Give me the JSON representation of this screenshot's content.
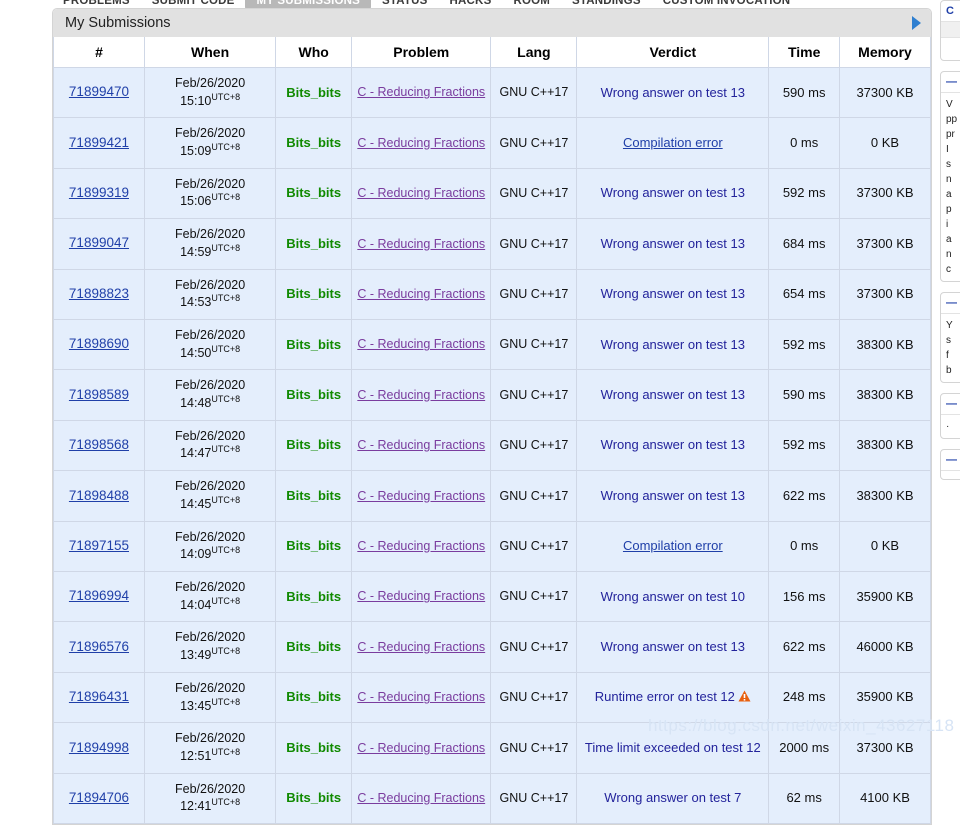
{
  "nav": {
    "tabs": [
      {
        "label": "PROBLEMS",
        "active": false
      },
      {
        "label": "SUBMIT CODE",
        "active": false
      },
      {
        "label": "MY SUBMISSIONS",
        "active": true
      },
      {
        "label": "STATUS",
        "active": false
      },
      {
        "label": "HACKS",
        "active": false
      },
      {
        "label": "ROOM",
        "active": false
      },
      {
        "label": "STANDINGS",
        "active": false
      },
      {
        "label": "CUSTOM INVOCATION",
        "active": false
      }
    ]
  },
  "panel": {
    "caption": "My Submissions",
    "collapse_arrow_icon": "triangle-right-icon",
    "accent_color": "#2f7fd0"
  },
  "table": {
    "columns": [
      "#",
      "When",
      "Who",
      "Problem",
      "Lang",
      "Verdict",
      "Time",
      "Memory"
    ],
    "rows": [
      {
        "id": "71899470",
        "date": "Feb/26/2020",
        "time": "15:10",
        "tz": "UTC+8",
        "who": "Bits_bits",
        "problem": "C - Reducing Fractions",
        "lang": "GNU C++17",
        "verdict": "Wrong answer on test 13",
        "verdict_is_link": false,
        "warn": false,
        "runtime": "590 ms",
        "memory": "37300 KB"
      },
      {
        "id": "71899421",
        "date": "Feb/26/2020",
        "time": "15:09",
        "tz": "UTC+8",
        "who": "Bits_bits",
        "problem": "C - Reducing Fractions",
        "lang": "GNU C++17",
        "verdict": "Compilation error",
        "verdict_is_link": true,
        "warn": false,
        "runtime": "0 ms",
        "memory": "0 KB"
      },
      {
        "id": "71899319",
        "date": "Feb/26/2020",
        "time": "15:06",
        "tz": "UTC+8",
        "who": "Bits_bits",
        "problem": "C - Reducing Fractions",
        "lang": "GNU C++17",
        "verdict": "Wrong answer on test 13",
        "verdict_is_link": false,
        "warn": false,
        "runtime": "592 ms",
        "memory": "37300 KB"
      },
      {
        "id": "71899047",
        "date": "Feb/26/2020",
        "time": "14:59",
        "tz": "UTC+8",
        "who": "Bits_bits",
        "problem": "C - Reducing Fractions",
        "lang": "GNU C++17",
        "verdict": "Wrong answer on test 13",
        "verdict_is_link": false,
        "warn": false,
        "runtime": "684 ms",
        "memory": "37300 KB"
      },
      {
        "id": "71898823",
        "date": "Feb/26/2020",
        "time": "14:53",
        "tz": "UTC+8",
        "who": "Bits_bits",
        "problem": "C - Reducing Fractions",
        "lang": "GNU C++17",
        "verdict": "Wrong answer on test 13",
        "verdict_is_link": false,
        "warn": false,
        "runtime": "654 ms",
        "memory": "37300 KB"
      },
      {
        "id": "71898690",
        "date": "Feb/26/2020",
        "time": "14:50",
        "tz": "UTC+8",
        "who": "Bits_bits",
        "problem": "C - Reducing Fractions",
        "lang": "GNU C++17",
        "verdict": "Wrong answer on test 13",
        "verdict_is_link": false,
        "warn": false,
        "runtime": "592 ms",
        "memory": "38300 KB"
      },
      {
        "id": "71898589",
        "date": "Feb/26/2020",
        "time": "14:48",
        "tz": "UTC+8",
        "who": "Bits_bits",
        "problem": "C - Reducing Fractions",
        "lang": "GNU C++17",
        "verdict": "Wrong answer on test 13",
        "verdict_is_link": false,
        "warn": false,
        "runtime": "590 ms",
        "memory": "38300 KB"
      },
      {
        "id": "71898568",
        "date": "Feb/26/2020",
        "time": "14:47",
        "tz": "UTC+8",
        "who": "Bits_bits",
        "problem": "C - Reducing Fractions",
        "lang": "GNU C++17",
        "verdict": "Wrong answer on test 13",
        "verdict_is_link": false,
        "warn": false,
        "runtime": "592 ms",
        "memory": "38300 KB"
      },
      {
        "id": "71898488",
        "date": "Feb/26/2020",
        "time": "14:45",
        "tz": "UTC+8",
        "who": "Bits_bits",
        "problem": "C - Reducing Fractions",
        "lang": "GNU C++17",
        "verdict": "Wrong answer on test 13",
        "verdict_is_link": false,
        "warn": false,
        "runtime": "622 ms",
        "memory": "38300 KB"
      },
      {
        "id": "71897155",
        "date": "Feb/26/2020",
        "time": "14:09",
        "tz": "UTC+8",
        "who": "Bits_bits",
        "problem": "C - Reducing Fractions",
        "lang": "GNU C++17",
        "verdict": "Compilation error",
        "verdict_is_link": true,
        "warn": false,
        "runtime": "0 ms",
        "memory": "0 KB"
      },
      {
        "id": "71896994",
        "date": "Feb/26/2020",
        "time": "14:04",
        "tz": "UTC+8",
        "who": "Bits_bits",
        "problem": "C - Reducing Fractions",
        "lang": "GNU C++17",
        "verdict": "Wrong answer on test 10",
        "verdict_is_link": false,
        "warn": false,
        "runtime": "156 ms",
        "memory": "35900 KB"
      },
      {
        "id": "71896576",
        "date": "Feb/26/2020",
        "time": "13:49",
        "tz": "UTC+8",
        "who": "Bits_bits",
        "problem": "C - Reducing Fractions",
        "lang": "GNU C++17",
        "verdict": "Wrong answer on test 13",
        "verdict_is_link": false,
        "warn": false,
        "runtime": "622 ms",
        "memory": "46000 KB"
      },
      {
        "id": "71896431",
        "date": "Feb/26/2020",
        "time": "13:45",
        "tz": "UTC+8",
        "who": "Bits_bits",
        "problem": "C - Reducing Fractions",
        "lang": "GNU C++17",
        "verdict": "Runtime error on test 12",
        "verdict_is_link": false,
        "warn": true,
        "runtime": "248 ms",
        "memory": "35900 KB"
      },
      {
        "id": "71894998",
        "date": "Feb/26/2020",
        "time": "12:51",
        "tz": "UTC+8",
        "who": "Bits_bits",
        "problem": "C - Reducing Fractions",
        "lang": "GNU C++17",
        "verdict": "Time limit exceeded on test 12",
        "verdict_is_link": false,
        "warn": false,
        "runtime": "2000 ms",
        "memory": "37300 KB"
      },
      {
        "id": "71894706",
        "date": "Feb/26/2020",
        "time": "12:41",
        "tz": "UTC+8",
        "who": "Bits_bits",
        "problem": "C - Reducing Fractions",
        "lang": "GNU C++17",
        "verdict": "Wrong answer on test 7",
        "verdict_is_link": false,
        "warn": false,
        "runtime": "62 ms",
        "memory": "4100 KB"
      }
    ]
  },
  "sidebar": {
    "boxes": [
      {
        "head": "C",
        "body": ""
      },
      {
        "head": "—",
        "body": "V\npp\npr\nI\ns\nn\na\np\ni\na\nn\nc"
      },
      {
        "head": "—",
        "body": "Y\ns\nf\nb"
      },
      {
        "head": "—",
        "body": "·"
      },
      {
        "head": "—",
        "body": ""
      }
    ]
  },
  "watermark": {
    "text": "https://blog.csdn.net/weixin_43627118"
  }
}
